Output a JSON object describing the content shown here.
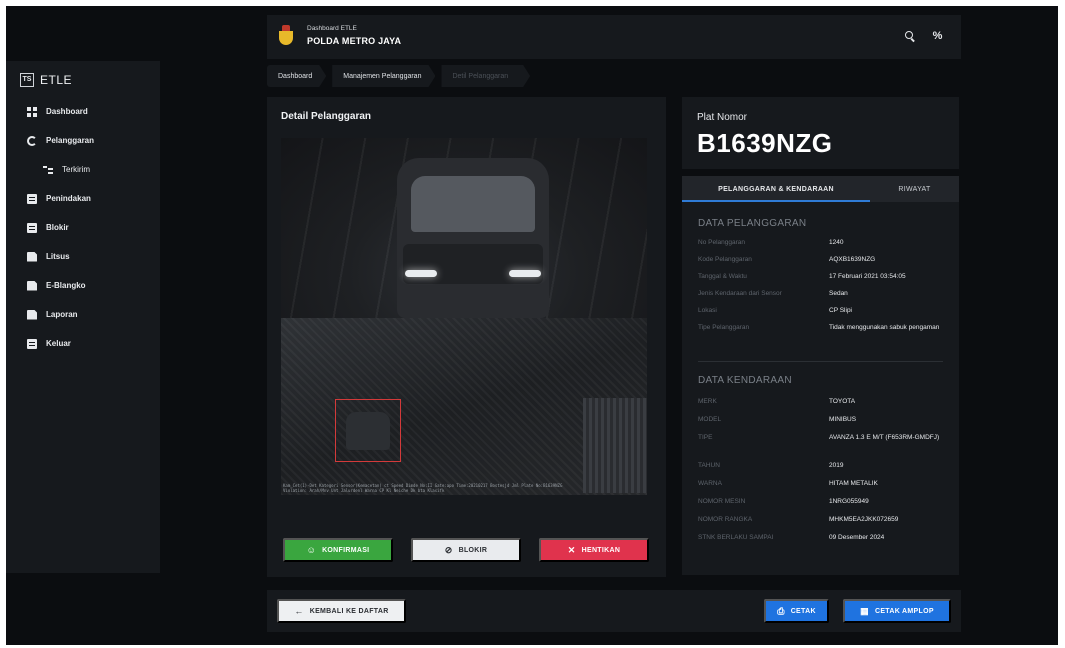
{
  "sidebar": {
    "brand_badge": "TS",
    "brand_name": "ETLE",
    "items": [
      {
        "label": "Dashboard",
        "icon": "dashboard-grid-icon"
      },
      {
        "label": "Pelanggaran",
        "icon": "circle-loading-icon"
      },
      {
        "label": "Terkirim",
        "icon": "sub-list-icon"
      },
      {
        "label": "Penindakan",
        "icon": "id-card-icon"
      },
      {
        "label": "Blokir",
        "icon": "block-card-icon"
      },
      {
        "label": "Litsus",
        "icon": "document-icon"
      },
      {
        "label": "E-Blangko",
        "icon": "blank-form-icon"
      },
      {
        "label": "Laporan",
        "icon": "report-icon"
      },
      {
        "label": "Keluar",
        "icon": "logout-icon"
      }
    ]
  },
  "header": {
    "subtitle": "Dashboard ETLE",
    "title": "POLDA METRO JAYA",
    "search_icon": "search-icon",
    "fx_icon": "fx-icon"
  },
  "breadcrumb": [
    "Dashboard",
    "Manajemen Pelanggaran",
    "Detil Pelanggaran"
  ],
  "detail": {
    "title": "Detail Pelanggaran",
    "camera_caption": "Kam_Cet(1)-Det Kategori Sensor(Kemacetan) ct Speed Dimde No:II Gate:apo Time:20210217 Bostesjd Jml Plate No:B1639NZG Violation: Arah/Mnv Unt Jalurdenl Warna CP Kl Neiche Dk bta Klasifk",
    "buttons": {
      "confirm": "KONFIRMASI",
      "block": "BLOKIR",
      "stop": "HENTIKAN"
    }
  },
  "plate": {
    "label": "Plat Nomor",
    "value": "B1639NZG"
  },
  "tabs": [
    "PELANGGARAN & KENDARAAN",
    "RIWAYAT"
  ],
  "violation": {
    "section_title": "DATA PELANGGARAN",
    "rows": [
      {
        "k": "No Pelanggaran",
        "v": "1240"
      },
      {
        "k": "Kode Pelanggaran",
        "v": "AQXB1639NZG"
      },
      {
        "k": "Tanggal & Waktu",
        "v": "17 Februari 2021 03:54:05"
      },
      {
        "k": "Jenis Kendaraan dari Sensor",
        "v": "Sedan"
      },
      {
        "k": "Lokasi",
        "v": "CP Slipi"
      },
      {
        "k": "Tipe Pelanggaran",
        "v": "Tidak menggunakan sabuk pengaman"
      }
    ]
  },
  "vehicle": {
    "section_title": "DATA KENDARAAN",
    "rows": [
      {
        "k": "MERK",
        "v": "TOYOTA"
      },
      {
        "k": "MODEL",
        "v": "MINIBUS"
      },
      {
        "k": "TIPE",
        "v": "AVANZA 1.3 E M/T (F653RM-GMDFJ)"
      },
      {
        "k": "TAHUN",
        "v": "2019"
      },
      {
        "k": "WARNA",
        "v": "HITAM METALIK"
      },
      {
        "k": "NOMOR MESIN",
        "v": "1NRG055949"
      },
      {
        "k": "NOMOR RANGKA",
        "v": "MHKM5EA2JKK072659"
      },
      {
        "k": "STNK BERLAKU SAMPAI",
        "v": "09 Desember 2024"
      }
    ]
  },
  "footer": {
    "back": "KEMBALI KE DAFTAR",
    "print": "CETAK",
    "print_envelope": "CETAK AMPLOP"
  },
  "colors": {
    "background": "#0b0d10",
    "panel": "#16191d",
    "accent_blue": "#1f73e0",
    "confirm_green": "#3aa63f",
    "stop_red": "#e0334d"
  }
}
